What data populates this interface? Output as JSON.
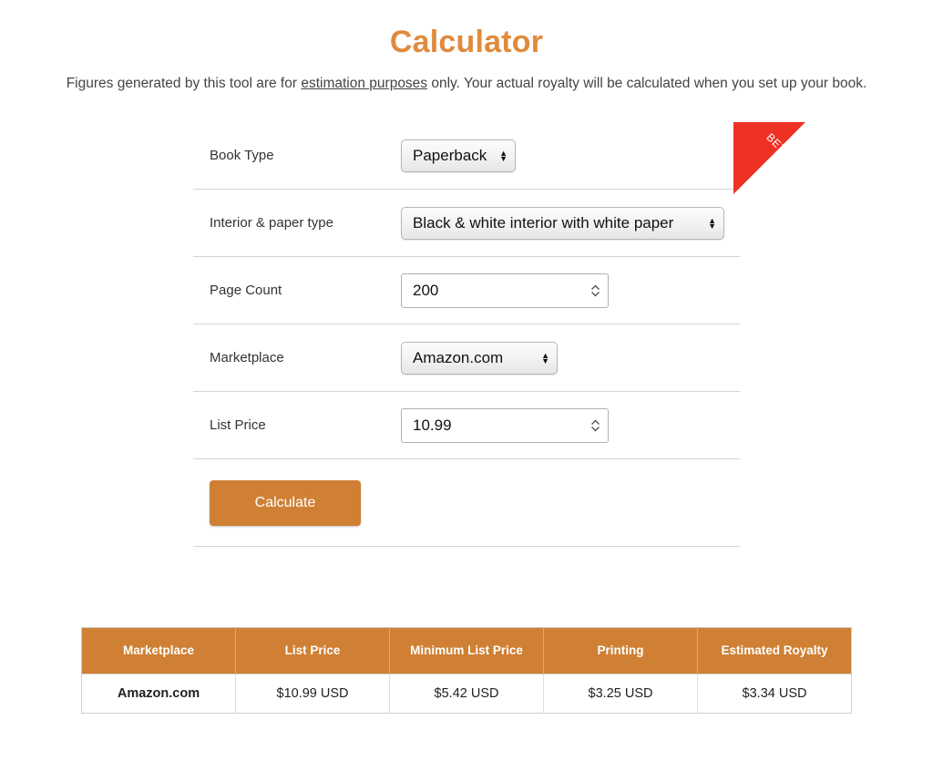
{
  "header": {
    "title": "Calculator",
    "subtitle_before": "Figures generated by this tool are for ",
    "subtitle_link": "estimation purposes",
    "subtitle_after": " only. Your actual royalty will be calculated when you set up your book."
  },
  "ribbon": {
    "label": "BETA",
    "color": "#ee3124"
  },
  "theme": {
    "accent": "#cf8034",
    "title_color": "#e08a3c"
  },
  "form": {
    "rows": [
      {
        "label": "Book Type",
        "value": "Paperback",
        "control": "select"
      },
      {
        "label": "Interior & paper type",
        "value": "Black & white interior with white paper",
        "control": "select"
      },
      {
        "label": "Page Count",
        "value": "200",
        "control": "number"
      },
      {
        "label": "Marketplace",
        "value": "Amazon.com",
        "control": "select"
      },
      {
        "label": "List Price",
        "value": "10.99",
        "control": "number"
      }
    ],
    "calculate_label": "Calculate"
  },
  "results": {
    "columns": [
      "Marketplace",
      "List Price",
      "Minimum List Price",
      "Printing",
      "Estimated Royalty"
    ],
    "rows": [
      {
        "marketplace": "Amazon.com",
        "list_price": "$10.99 USD",
        "minimum_list_price": "$5.42 USD",
        "printing": "$3.25 USD",
        "estimated_royalty": "$3.34 USD"
      }
    ]
  }
}
